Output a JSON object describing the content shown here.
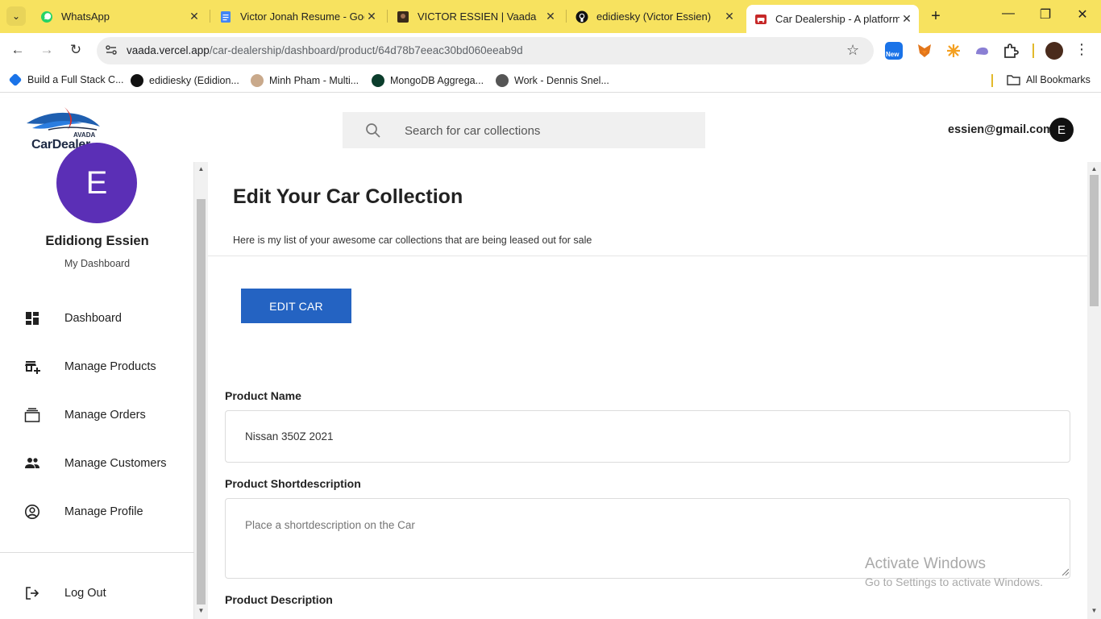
{
  "browser": {
    "tabs": [
      {
        "title": "WhatsApp",
        "icon": "whatsapp-icon",
        "color": "#25d366"
      },
      {
        "title": "Victor Jonah Resume - Goo",
        "icon": "google-docs-icon",
        "color": "#4285f4"
      },
      {
        "title": "VICTOR ESSIEN | Vaada",
        "icon": "vaada-icon",
        "color": "#3a2a1a"
      },
      {
        "title": "edidiesky (Victor Essien)",
        "icon": "github-icon",
        "color": "#111111"
      },
      {
        "title": "Car Dealership - A platform",
        "icon": "car-dealer-icon",
        "color": "#c62828"
      }
    ],
    "url_host": "vaada.vercel.app",
    "url_path": "/car-dealership/dashboard/product/64d78b7eeac30bd060eeab9d",
    "ext_badge": "New",
    "bookmarks": [
      {
        "label": "Build a Full Stack C...",
        "color": "#1a73e8"
      },
      {
        "label": "edidiesky (Edidion...",
        "color": "#111111"
      },
      {
        "label": "Minh Pham - Multi...",
        "color": "#c9a98b"
      },
      {
        "label": "MongoDB Aggrega...",
        "color": "#0b3d2c"
      },
      {
        "label": "Work - Dennis Snel...",
        "color": "#555555"
      }
    ],
    "all_bookmarks": "All Bookmarks"
  },
  "header": {
    "logo_top": "AVADA",
    "logo_text": "CarDealer",
    "search_placeholder": "Search for car collections",
    "user_email": "essien@gmail.com",
    "user_initial": "E"
  },
  "sidebar": {
    "avatar_initial": "E",
    "name": "Edidiong Essien",
    "subtitle": "My Dashboard",
    "items": [
      {
        "label": "Dashboard",
        "icon": "dashboard-icon"
      },
      {
        "label": "Manage Products",
        "icon": "store-add-icon"
      },
      {
        "label": "Manage Orders",
        "icon": "orders-stack-icon"
      },
      {
        "label": "Manage Customers",
        "icon": "people-icon"
      },
      {
        "label": "Manage Profile",
        "icon": "account-circle-icon"
      }
    ],
    "logout": "Log Out"
  },
  "main": {
    "title": "Edit Your Car Collection",
    "subtitle": "Here is my list of your awesome car collections that are being leased out for sale",
    "edit_button": "EDIT CAR",
    "fields": {
      "name_label": "Product Name",
      "name_value": "Nissan 350Z 2021",
      "short_label": "Product Shortdescription",
      "short_placeholder": "Place a shortdescription on the Car",
      "desc_label": "Product Description"
    }
  },
  "watermark": {
    "line1": "Activate Windows",
    "line2": "Go to Settings to activate Windows."
  },
  "colors": {
    "accent": "#2463c2",
    "avatar": "#5b2fb6",
    "tabbar": "#f7e25f"
  }
}
